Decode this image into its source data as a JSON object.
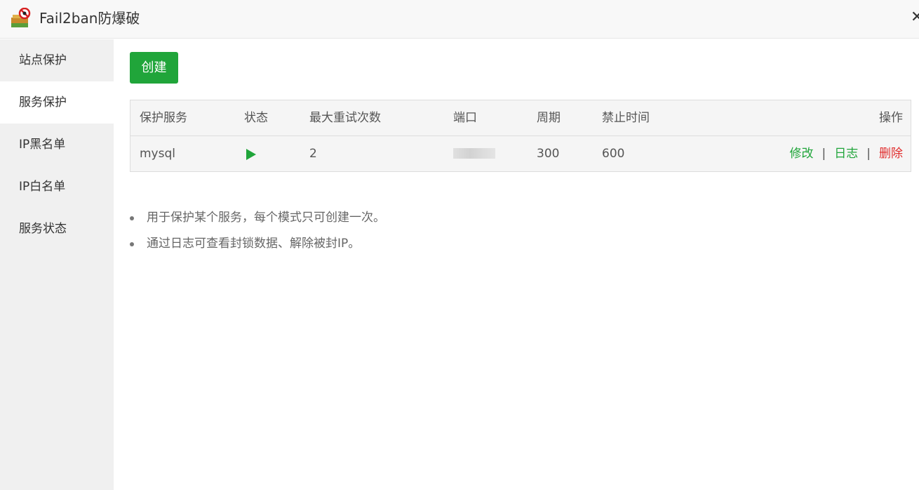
{
  "window": {
    "title": "Fail2ban防爆破",
    "icon": "app-logo-icon",
    "close_icon": "close-icon"
  },
  "sidebar": {
    "items": [
      {
        "label": "站点保护",
        "active": false
      },
      {
        "label": "服务保护",
        "active": true
      },
      {
        "label": "IP黑名单",
        "active": false
      },
      {
        "label": "IP白名单",
        "active": false
      },
      {
        "label": "服务状态",
        "active": false
      }
    ]
  },
  "toolbar": {
    "create_label": "创建"
  },
  "table": {
    "headers": {
      "service": "保护服务",
      "status": "状态",
      "max_retry": "最大重试次数",
      "port": "端口",
      "cycle": "周期",
      "ban_time": "禁止时间",
      "actions": "操作"
    },
    "rows": [
      {
        "service": "mysql",
        "status_icon": "play-icon",
        "max_retry": "2",
        "cycle": "300",
        "ban_time": "600",
        "actions": {
          "edit": "修改",
          "log": "日志",
          "delete": "删除",
          "separator": "|"
        }
      }
    ]
  },
  "tips": [
    "用于保护某个服务，每个模式只可创建一次。",
    "通过日志可查看封锁数据、解除被封IP。"
  ],
  "colors": {
    "accent": "#20a53a",
    "danger": "#e02d2d",
    "sidebar_bg": "#f0f0f0",
    "table_bg": "#f5f5f5"
  }
}
